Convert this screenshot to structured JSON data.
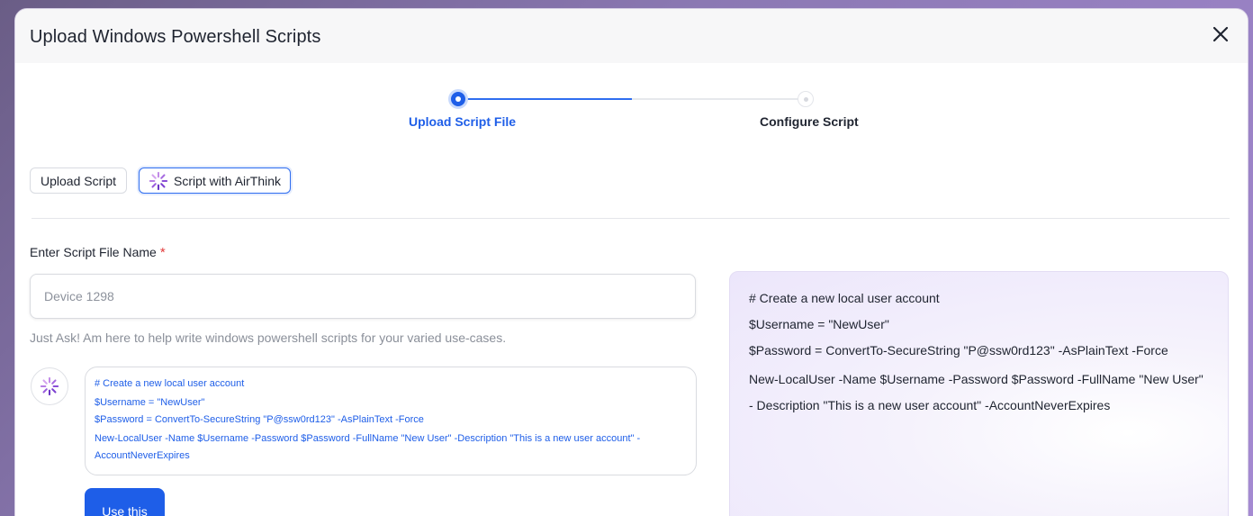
{
  "modal": {
    "title": "Upload Windows Powershell Scripts"
  },
  "stepper": {
    "steps": [
      {
        "label": "Upload Script File",
        "state": "active"
      },
      {
        "label": "Configure Script",
        "state": "pending"
      }
    ]
  },
  "tabs": {
    "upload": "Upload Script",
    "airthink": "Script with AirThink"
  },
  "form": {
    "name_label": "Enter Script File Name",
    "required_mark": "*",
    "name_placeholder": "Device 1298",
    "name_value": "",
    "helper": "Just Ask! Am here to help write windows powershell scripts for your varied use-cases."
  },
  "ai_response": {
    "lines": [
      "# Create a new local user account",
      "$Username = \"NewUser\"",
      "$Password = ConvertTo-SecureString \"P@ssw0rd123\" -AsPlainText -Force",
      "New-LocalUser -Name $Username -Password $Password -FullName \"New User\" -Description \"This is a new user account\" -AccountNeverExpires"
    ],
    "use_button": "Use this"
  },
  "preview": {
    "lines": [
      "# Create a new local user account",
      "$Username = \"NewUser\"",
      "$Password = ConvertTo-SecureString \"P@ssw0rd123\" -AsPlainText -Force",
      "New-LocalUser -Name $Username -Password $Password -FullName \"New User\" - Description \"This is a new user account\" -AccountNeverExpires"
    ]
  },
  "colors": {
    "accent": "#1e5ee8",
    "required": "#e23b3b"
  },
  "icons": {
    "close": "close-icon",
    "airthink": "sparkle-spinner-icon"
  }
}
